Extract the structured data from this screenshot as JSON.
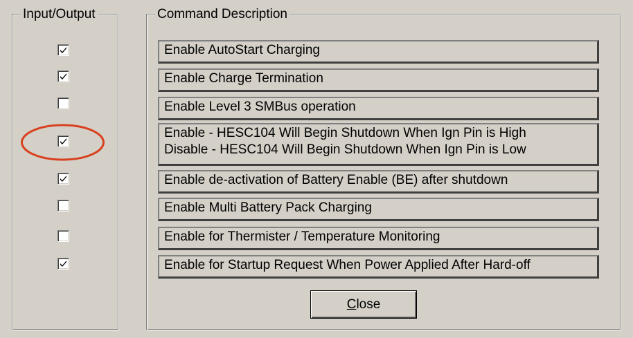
{
  "input_output": {
    "title": "Input/Output",
    "checkboxes": [
      {
        "checked": true
      },
      {
        "checked": true
      },
      {
        "checked": false
      },
      {
        "checked": true
      },
      {
        "checked": true
      },
      {
        "checked": false
      },
      {
        "checked": false
      },
      {
        "checked": true
      }
    ]
  },
  "command_description": {
    "title": "Command Description",
    "items": [
      {
        "lines": [
          "Enable AutoStart Charging"
        ]
      },
      {
        "lines": [
          "Enable Charge Termination"
        ]
      },
      {
        "lines": [
          "Enable Level 3 SMBus operation"
        ]
      },
      {
        "lines": [
          "Enable - HESC104 Will Begin Shutdown When Ign Pin is High",
          "Disable - HESC104 Will Begin Shutdown When Ign Pin is Low"
        ]
      },
      {
        "lines": [
          "Enable de-activation of Battery Enable (BE) after shutdown"
        ]
      },
      {
        "lines": [
          "Enable Multi Battery Pack Charging"
        ]
      },
      {
        "lines": [
          "Enable for Thermister / Temperature Monitoring"
        ]
      },
      {
        "lines": [
          "Enable for Startup Request When Power Applied After Hard-off"
        ]
      }
    ]
  },
  "close_button": {
    "mnemonic": "C",
    "rest": "lose"
  },
  "annotation": {
    "color": "#d9401e"
  }
}
